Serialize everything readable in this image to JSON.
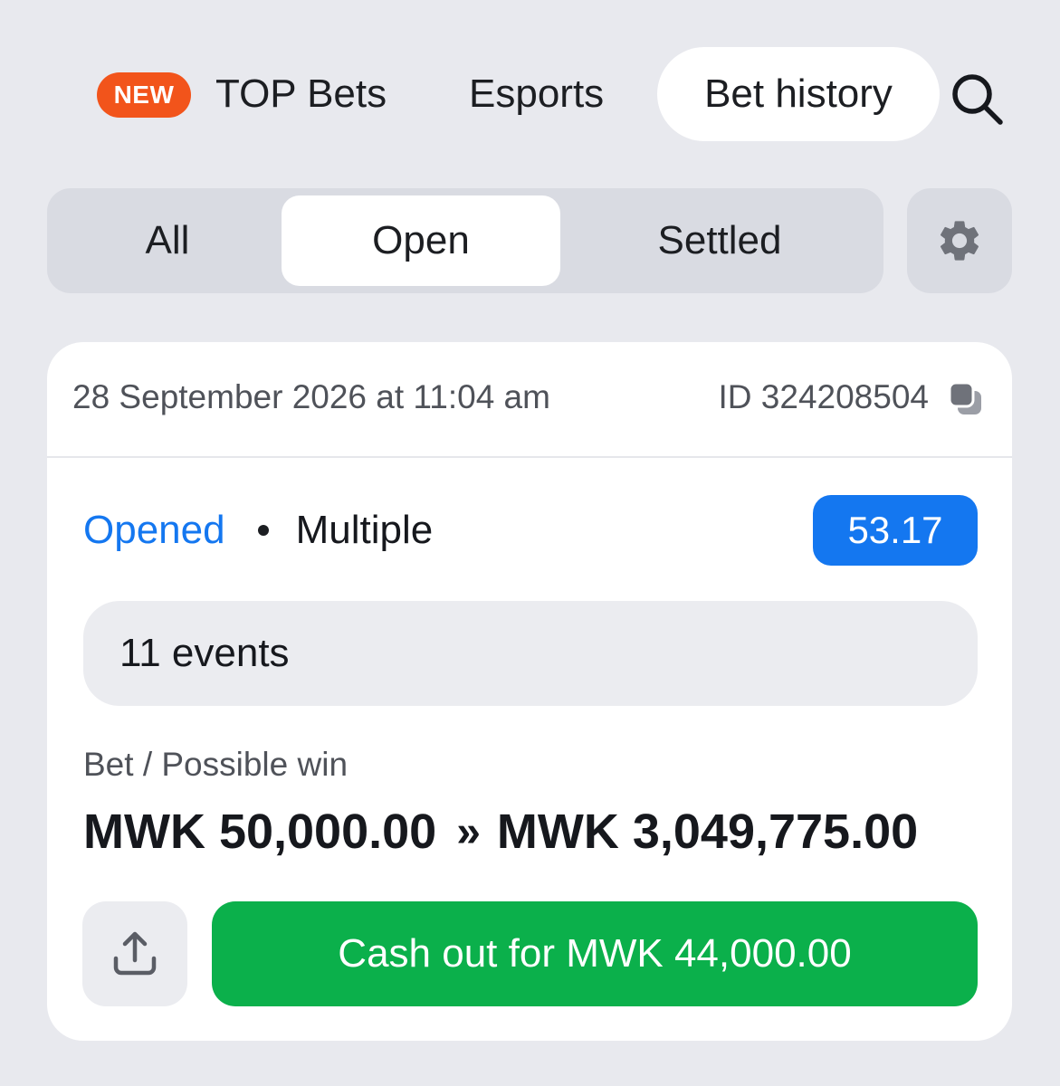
{
  "nav": {
    "new_badge": "NEW",
    "top_bets": "TOP Bets",
    "esports": "Esports",
    "bet_history": "Bet history",
    "search_icon": "search-icon"
  },
  "filters": {
    "all": "All",
    "open": "Open",
    "settled": "Settled",
    "selected": "Open",
    "settings_icon": "gear-icon"
  },
  "bet": {
    "date": "28 September 2026 at 11:04 am",
    "id": "ID 324208504",
    "status": "Opened",
    "separator": "•",
    "type": "Multiple",
    "odds": "53.17",
    "events": "11 events",
    "amount_label": "Bet / Possible win",
    "stake": "MWK 50,000.00",
    "arrow": "»",
    "possible_win": "MWK 3,049,775.00",
    "cashout": "Cash out for MWK 44,000.00"
  },
  "colors": {
    "background": "#e8e9ee",
    "new_badge": "#f2541b",
    "accent_blue": "#1477f0",
    "cashout_green": "#0bb04b"
  }
}
